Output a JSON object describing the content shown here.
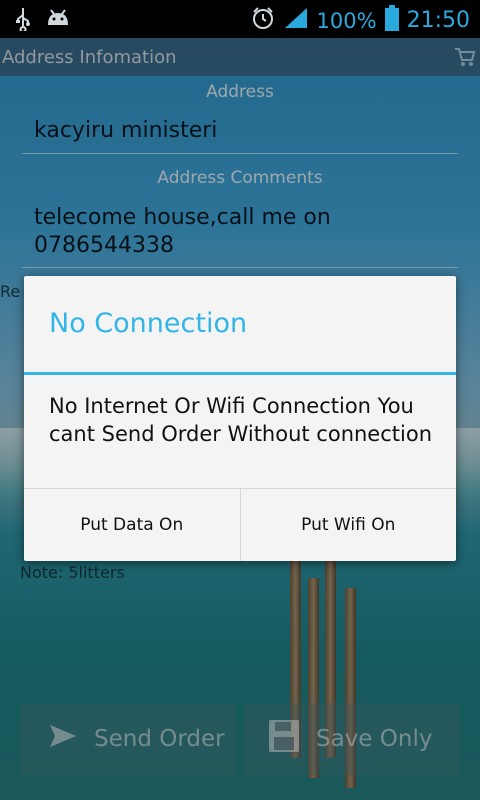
{
  "status_bar": {
    "battery_percent": "100%",
    "time": "21:50",
    "icons": [
      "usb-icon",
      "android-icon",
      "alarm-icon",
      "signal-icon",
      "battery-icon"
    ]
  },
  "app": {
    "title": "Address Infomation",
    "address_label": "Address",
    "address_value": "kacyiru ministeri",
    "comments_label": "Address Comments",
    "comments_value": "telecome house,call me on 0786544338",
    "partial_left_text": "Re",
    "note": "Note: 5litters",
    "send_button_label": "Send Order",
    "save_button_label": "Save Only"
  },
  "dialog": {
    "title": "No Connection",
    "message": "No Internet Or Wifi Connection You cant Send Order Without connection",
    "button_data": "Put Data On",
    "button_wifi": "Put Wifi On"
  },
  "colors": {
    "accent": "#33b5e5",
    "status_icons": "#2aa9dd"
  }
}
